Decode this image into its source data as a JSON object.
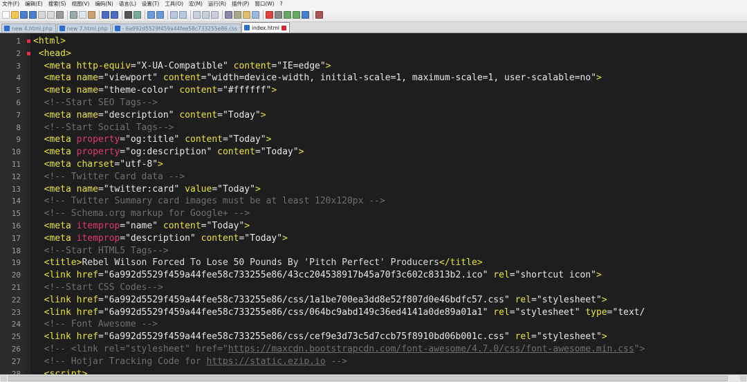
{
  "menu": [
    "文件(F)",
    "编辑(E)",
    "搜索(S)",
    "视图(V)",
    "编码(N)",
    "语言(L)",
    "设置(T)",
    "工具(O)",
    "宏(M)",
    "运行(R)",
    "插件(P)",
    "窗口(W)",
    "?"
  ],
  "tabs": [
    {
      "label": "new 4.html.php"
    },
    {
      "label": "new 7.html.php"
    },
    {
      "label": "- 6a992d5529f459a44fee58c733255e86.css"
    },
    {
      "label": "index.html"
    }
  ],
  "code_lines": [
    {
      "n": "1",
      "fold": true,
      "code": "<html>"
    },
    {
      "n": "2",
      "fold": true,
      "code": " <head>"
    },
    {
      "n": "3",
      "code": "  <meta http-equiv=\"X-UA-Compatible\" content=\"IE=edge\">"
    },
    {
      "n": "4",
      "code": "  <meta name=\"viewport\" content=\"width=device-width, initial-scale=1, maximum-scale=1, user-scalable=no\">"
    },
    {
      "n": "5",
      "code": "  <meta name=\"theme-color\" content=\"#ffffff\">"
    },
    {
      "n": "6",
      "code": "  <!--Start SEO Tags-->"
    },
    {
      "n": "7",
      "code": "  <meta name=\"description\" content=\"Today\">"
    },
    {
      "n": "8",
      "code": "  <!--Start Social Tags-->"
    },
    {
      "n": "9",
      "code": "  <meta property=\"og:title\" content=\"Today\">"
    },
    {
      "n": "10",
      "code": "  <meta property=\"og:description\" content=\"Today\">"
    },
    {
      "n": "11",
      "code": "  <meta charset=\"utf-8\">"
    },
    {
      "n": "12",
      "code": "  <!-- Twitter Card data -->"
    },
    {
      "n": "13",
      "code": "  <meta name=\"twitter:card\" value=\"Today\">"
    },
    {
      "n": "14",
      "code": "  <!-- Twitter Summary card images must be at least 120x120px -->"
    },
    {
      "n": "15",
      "code": "  <!-- Schema.org markup for Google+ -->"
    },
    {
      "n": "16",
      "code": "  <meta itemprop=\"name\" content=\"Today\">"
    },
    {
      "n": "17",
      "code": "  <meta itemprop=\"description\" content=\"Today\">"
    },
    {
      "n": "18",
      "code": "  <!--Start HTML5 Tags-->"
    },
    {
      "n": "19",
      "code": "  <title>Rebel Wilson Forced To Lose 50 Pounds By 'Pitch Perfect' Producers</title>"
    },
    {
      "n": "20",
      "code": "  <link href=\"6a992d5529f459a44fee58c733255e86/43cc204538917b45a70f3c602c8313b2.ico\" rel=\"shortcut icon\">"
    },
    {
      "n": "21",
      "code": "  <!--Start CSS Codes-->"
    },
    {
      "n": "22",
      "code": "  <link href=\"6a992d5529f459a44fee58c733255e86/css/1a1be700ea3dd8e52f807d0e46bdfc57.css\" rel=\"stylesheet\">"
    },
    {
      "n": "23",
      "code": "  <link href=\"6a992d5529f459a44fee58c733255e86/css/064bc9abd149c36ed4141a0de89a01a1\" rel=\"stylesheet\" type=\"text/"
    },
    {
      "n": "24",
      "code": "  <!-- Font Awesome -->"
    },
    {
      "n": "25",
      "code": "  <link href=\"6a992d5529f459a44fee58c733255e86/css/cef9e3d73c5d7ccb75f8910bd06b001c.css\" rel=\"stylesheet\">"
    },
    {
      "n": "26",
      "code": "  <!-- <link rel=\"stylesheet\" href=\"https://maxcdn.bootstrapcdn.com/font-awesome/4.7.0/css/font-awesome.min.css\">"
    },
    {
      "n": "27",
      "code": "  <!-- Hotjar Tracking Code for https://static.ezip.io -->"
    },
    {
      "n": "28",
      "code": "  <script>"
    }
  ],
  "colors": {
    "editor_bg": "#1e1e1e",
    "tag": "#e8e43a",
    "attr_special": "#e03a6a",
    "comment": "#6f6f6f",
    "text": "#dcdcdc"
  }
}
